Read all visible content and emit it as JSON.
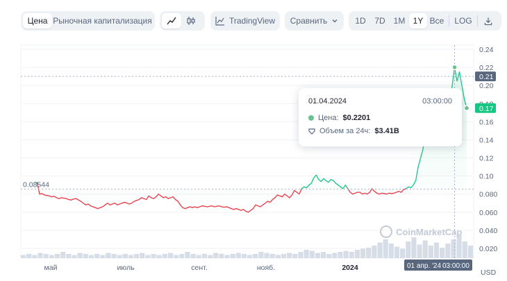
{
  "toolbar": {
    "view_tabs": [
      {
        "label": "Цена",
        "active": true
      },
      {
        "label": "Рыночная капитализация",
        "active": false
      }
    ],
    "chart_type": [
      {
        "icon": "line-chart-icon",
        "active": true
      },
      {
        "icon": "candlestick-icon",
        "active": false
      }
    ],
    "tradingview_label": "TradingView",
    "compare_label": "Сравнить",
    "ranges": [
      {
        "label": "1D",
        "active": false
      },
      {
        "label": "7D",
        "active": false
      },
      {
        "label": "1M",
        "active": false
      },
      {
        "label": "1Y",
        "active": true
      },
      {
        "label": "Все",
        "active": false
      }
    ],
    "log_label": "LOG",
    "download_icon": "download-icon"
  },
  "tooltip": {
    "date": "01.04.2024",
    "time": "03:00:00",
    "price_label": "Цена:",
    "price_value": "$0.2201",
    "volume_label": "Объем за 24ч:",
    "volume_value": "$3.41B"
  },
  "watermark": "CoinMarketCap",
  "colors": {
    "up": "#16c784",
    "down": "#ea3943",
    "accent_line": "#6bc28f"
  },
  "chart_data": {
    "type": "line",
    "currency": "USD",
    "y_ticks": [
      "0.24",
      "0.22",
      "0.20",
      "0.18",
      "0.16",
      "0.14",
      "0.12",
      "0.10",
      "0.080",
      "0.060",
      "0.040",
      "0.020"
    ],
    "ylim": [
      0.0,
      0.245
    ],
    "x_ticks": [
      {
        "label": "май",
        "bold": false
      },
      {
        "label": "июль",
        "bold": false
      },
      {
        "label": "сент.",
        "bold": false
      },
      {
        "label": "нояб.",
        "bold": false
      },
      {
        "label": "2024",
        "bold": true
      }
    ],
    "reference_price": "0.08544",
    "current_price_label": "0.21",
    "last_price_label": "0.17",
    "crosshair_x_label": "01 апр. '24",
    "crosshair_time_label": "03:00:00",
    "price_series": [
      [
        0.093,
        0.0925,
        0.08,
        0.0805,
        0.079,
        0.0785,
        0.078,
        0.077,
        0.0775,
        0.076,
        0.075,
        0.076,
        0.0755,
        0.075,
        0.074,
        0.0735,
        0.0745,
        0.075,
        0.0735,
        0.072,
        0.07,
        0.068,
        0.069,
        0.067,
        0.066,
        0.065,
        0.064,
        0.065,
        0.066,
        0.068,
        0.07,
        0.068,
        0.069,
        0.07,
        0.068,
        0.069,
        0.07,
        0.071,
        0.07,
        0.069,
        0.07,
        0.072,
        0.073,
        0.074,
        0.076,
        0.075,
        0.074,
        0.078,
        0.076,
        0.075,
        0.077,
        0.08,
        0.078,
        0.076,
        0.077,
        0.075,
        0.076,
        0.077,
        0.074,
        0.072,
        0.068,
        0.065,
        0.064,
        0.065,
        0.066,
        0.065,
        0.066,
        0.065,
        0.066,
        0.067,
        0.0665,
        0.066,
        0.0665,
        0.067,
        0.066,
        0.0665,
        0.067,
        0.066,
        0.0655,
        0.066,
        0.065,
        0.064,
        0.063,
        0.064,
        0.063,
        0.062,
        0.063,
        0.061,
        0.06,
        0.062,
        0.064,
        0.068,
        0.067,
        0.066,
        0.068,
        0.07,
        0.072,
        0.071,
        0.074,
        0.076,
        0.079,
        0.078,
        0.077,
        0.08,
        0.078,
        0.076,
        0.079,
        0.084,
        0.082,
        0.08,
        0.086,
        0.088,
        0.087,
        0.09,
        0.092,
        0.098,
        0.101,
        0.096,
        0.094,
        0.097,
        0.095,
        0.093,
        0.096,
        0.095,
        0.092,
        0.09,
        0.088,
        0.086,
        0.09,
        0.086,
        0.082,
        0.08,
        0.081,
        0.082,
        0.082,
        0.08,
        0.081,
        0.08,
        0.082,
        0.086,
        0.083,
        0.081,
        0.08,
        0.081,
        0.0805,
        0.08,
        0.081,
        0.0805,
        0.081,
        0.082,
        0.083,
        0.082,
        0.085,
        0.086,
        0.088,
        0.087,
        0.09,
        0.095,
        0.11,
        0.12,
        0.13,
        0.15,
        0.17,
        0.18,
        0.19,
        0.18,
        0.15,
        0.16,
        0.17,
        0.165,
        0.18,
        0.175,
        0.2,
        0.2201,
        0.205,
        0.215,
        0.2,
        0.185,
        0.175
      ]
    ],
    "volume_series": [
      0.003,
      0.004,
      0.003,
      0.005,
      0.004,
      0.003,
      0.004,
      0.006,
      0.004,
      0.003,
      0.005,
      0.004,
      0.003,
      0.004,
      0.003,
      0.005,
      0.004,
      0.003,
      0.004,
      0.003,
      0.004,
      0.005,
      0.003,
      0.004,
      0.003,
      0.004,
      0.005,
      0.003,
      0.004,
      0.006,
      0.004,
      0.003,
      0.004,
      0.003,
      0.005,
      0.004,
      0.003,
      0.004,
      0.005,
      0.004,
      0.003,
      0.004,
      0.006,
      0.005,
      0.004,
      0.003,
      0.004,
      0.005,
      0.004,
      0.006,
      0.008,
      0.007,
      0.005,
      0.006,
      0.004,
      0.005,
      0.006,
      0.007,
      0.006,
      0.008,
      0.009,
      0.01,
      0.012,
      0.015,
      0.018,
      0.014,
      0.011,
      0.009,
      0.016,
      0.02,
      0.013,
      0.017,
      0.012,
      0.015,
      0.01,
      0.014,
      0.018,
      0.022,
      0.016,
      0.012
    ]
  }
}
